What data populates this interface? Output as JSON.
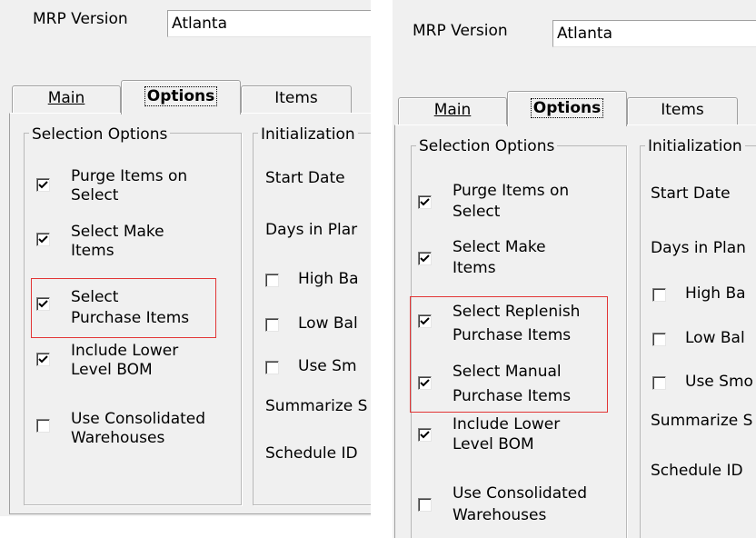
{
  "left": {
    "mrp_version_label": "MRP Version",
    "mrp_version_value": "Atlanta",
    "tabs": {
      "main": "Main",
      "options": "Options",
      "items": "Items"
    },
    "selection_group": "Selection Options",
    "options": [
      {
        "line1": "Purge Items on",
        "line2": "Select",
        "checked": true
      },
      {
        "line1": "Select Make",
        "line2": "Items",
        "checked": true
      },
      {
        "line1": "Select",
        "line2": "Purchase Items",
        "checked": true
      },
      {
        "line1": "Include Lower",
        "line2": "Level BOM",
        "checked": true
      },
      {
        "line1": "Use Consolidated",
        "line2": "Warehouses",
        "checked": false
      }
    ],
    "init_group": "Initialization",
    "init": {
      "start_date": "Start Date",
      "days_in_plan": "Days in Plar",
      "high_bal": "High Ba",
      "low_bal": "Low Bal",
      "use_sm": "Use Sm",
      "summarize": "Summarize S",
      "schedule_id": "Schedule ID"
    }
  },
  "right": {
    "mrp_version_label": "MRP Version",
    "mrp_version_value": "Atlanta",
    "tabs": {
      "main": "Main",
      "options": "Options",
      "items": "Items"
    },
    "selection_group": "Selection Options",
    "options": [
      {
        "line1": "Purge Items on",
        "line2": "Select",
        "checked": true
      },
      {
        "line1": "Select Make",
        "line2": "Items",
        "checked": true
      },
      {
        "line1": "Select Replenish",
        "line2": "Purchase Items",
        "checked": true
      },
      {
        "line1": "Select Manual",
        "line2": "Purchase Items",
        "checked": true
      },
      {
        "line1": "Include Lower",
        "line2": "Level BOM",
        "checked": true
      },
      {
        "line1": "Use Consolidated",
        "line2": "Warehouses",
        "checked": false
      }
    ],
    "init_group": "Initialization",
    "init": {
      "start_date": "Start Date",
      "days_in_plan": "Days in Plan",
      "high_bal": "High Ba",
      "low_bal": "Low Bal",
      "use_sm": "Use Smo",
      "summarize": "Summarize S",
      "schedule_id": "Schedule ID"
    }
  }
}
